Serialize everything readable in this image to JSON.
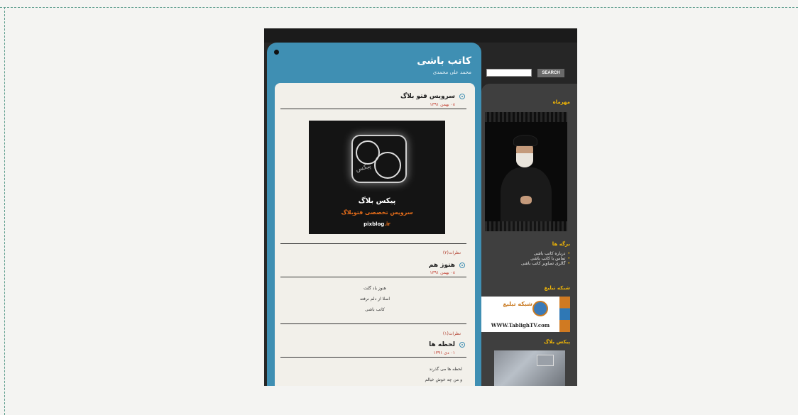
{
  "blog": {
    "title": "کاتب باشی",
    "subtitle": "محمد علی محمدی"
  },
  "search": {
    "button_label": "SEARCH",
    "placeholder": ""
  },
  "posts": [
    {
      "title": "سرویس فتو بلاگ",
      "date": "۰۸ بهمن ۱۳۹۱",
      "promo": {
        "name": "پیکس بلاگ",
        "tagline": "سرویس تخصصی فتوبلاگ",
        "url_main": "pixblog",
        "url_ext": ".ir",
        "logo_text": "پیکس"
      }
    },
    {
      "comments": "نظرات(۲)",
      "title": "هنوز هم",
      "date": "۰۸ بهمن ۱۳۹۱",
      "lines": [
        "هنوز یاد گلت",
        "اصلا از دلم نرفته",
        "کاتب باشی"
      ]
    },
    {
      "comments": "نظرات(۱)",
      "title": "لحظه ها",
      "date": "۰۱ دی ۱۳۹۱",
      "lines": [
        "لحظه ها می گذرند",
        "و من چه خوش خیالم"
      ]
    }
  ],
  "sidebar": {
    "photo_heading": "مهرماه",
    "pages_heading": "برگه ها",
    "pages": [
      "درباره کاتب باشی",
      "تماس با کاتب باشی",
      "گالری تصاویر کاتب باشی"
    ],
    "ads_heading": "شبکه تبلیغ",
    "ad": {
      "brand": "شبکه تبلیغ",
      "url": "WWW.TablighTV.com"
    },
    "pix_heading": "پیکس بلاگ"
  }
}
